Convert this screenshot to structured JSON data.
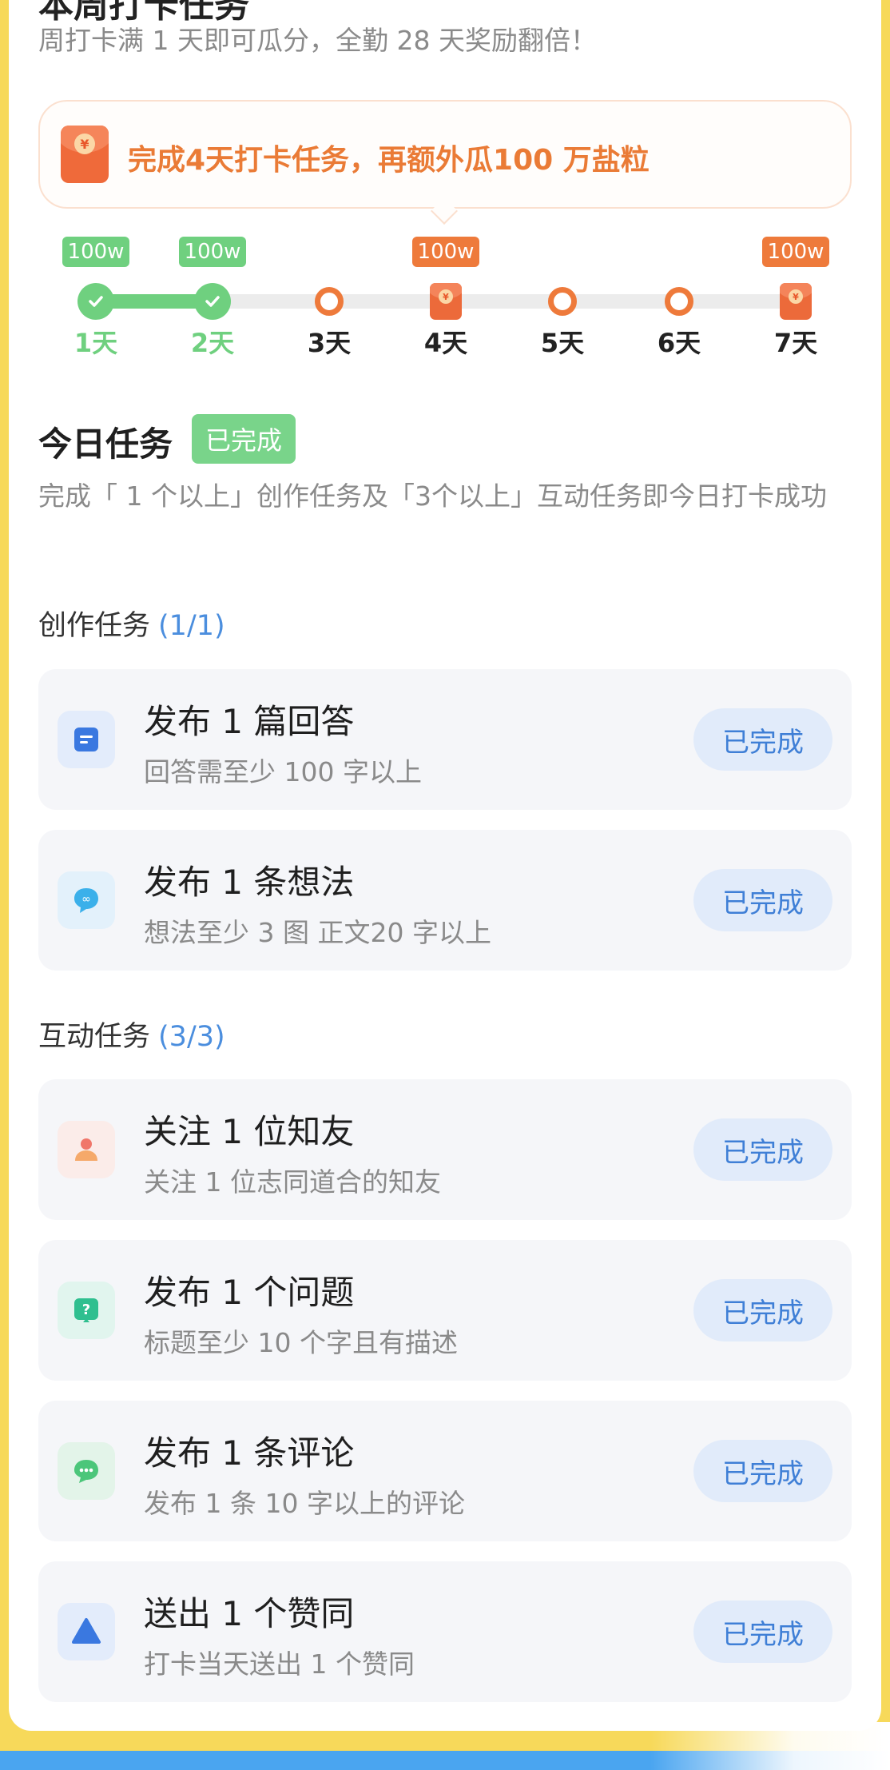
{
  "header": {
    "cut_title": "本周打卡任务",
    "subtitle": "周打卡满 1 天即可瓜分，全勤 28 天奖励翻倍！"
  },
  "bonus": {
    "icon": "red-packet-icon",
    "text": "完成4天打卡任务，再额外瓜100 万盐粒"
  },
  "progress": {
    "completed_days": 2,
    "days": [
      {
        "label": "1天",
        "reward": "100w",
        "state": "done"
      },
      {
        "label": "2天",
        "reward": "100w",
        "state": "done"
      },
      {
        "label": "3天",
        "reward": "",
        "state": "pending"
      },
      {
        "label": "4天",
        "reward": "100w",
        "state": "bonus"
      },
      {
        "label": "5天",
        "reward": "",
        "state": "pending"
      },
      {
        "label": "6天",
        "reward": "",
        "state": "pending"
      },
      {
        "label": "7天",
        "reward": "100w",
        "state": "bonus"
      }
    ]
  },
  "today": {
    "title": "今日任务",
    "badge": "已完成",
    "description": "完成「 1 个以上」创作任务及「3个以上」互动任务即今日打卡成功"
  },
  "creation": {
    "title": "创作任务",
    "count": "(1/1)",
    "tasks": [
      {
        "title": "发布 1 篇回答",
        "sub": "回答需至少 100 字以上",
        "button": "已完成",
        "icon": "answer-doc-icon"
      },
      {
        "title": "发布 1 条想法",
        "sub": "想法至少 3 图 正文20 字以上",
        "button": "已完成",
        "icon": "idea-bubble-icon"
      }
    ]
  },
  "interaction": {
    "title": "互动任务",
    "count": "(3/3)",
    "tasks": [
      {
        "title": "关注 1 位知友",
        "sub": "关注 1 位志同道合的知友",
        "button": "已完成",
        "icon": "follow-user-icon"
      },
      {
        "title": "发布 1 个问题",
        "sub": "标题至少 10 个字且有描述",
        "button": "已完成",
        "icon": "question-icon"
      },
      {
        "title": "发布 1 条评论",
        "sub": "发布 1 条 10 字以上的评论",
        "button": "已完成",
        "icon": "comment-icon"
      },
      {
        "title": "送出 1 个赞同",
        "sub": "打卡当天送出 1 个赞同",
        "button": "已完成",
        "icon": "upvote-icon"
      }
    ]
  },
  "colors": {
    "green": "#6fd07f",
    "orange": "#ee7a3b",
    "blue": "#3f7fd6",
    "border_yellow": "#f7d95a"
  }
}
